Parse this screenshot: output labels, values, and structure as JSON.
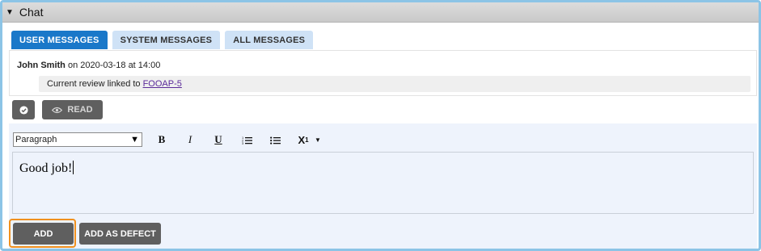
{
  "panel": {
    "title": "Chat",
    "collapse_icon": "caret-down-icon"
  },
  "tabs": [
    {
      "label": "USER MESSAGES",
      "active": true
    },
    {
      "label": "SYSTEM MESSAGES",
      "active": false
    },
    {
      "label": "ALL MESSAGES",
      "active": false
    }
  ],
  "message": {
    "author": "John Smith",
    "timestamp": "on 2020-03-18 at 14:00",
    "body_text": "Current review linked to",
    "link_text": "FOOAP-5"
  },
  "actions": {
    "check_icon": "check-circle-icon",
    "read_label": "READ",
    "read_icon": "eye-icon"
  },
  "editor": {
    "format_selected": "Paragraph",
    "content": "Good job!",
    "tools": [
      "bold",
      "italic",
      "underline",
      "ordered-list",
      "unordered-list",
      "subscript"
    ]
  },
  "buttons": {
    "add_label": "ADD",
    "add_defect_label": "ADD AS DEFECT"
  },
  "colors": {
    "active_tab": "#1a78c9",
    "inactive_tab": "#cfe2f6",
    "button": "#5f5f5f",
    "focus_outline": "#f0901e",
    "editor_bg": "#eef3fc",
    "link": "#5b2a9a"
  }
}
